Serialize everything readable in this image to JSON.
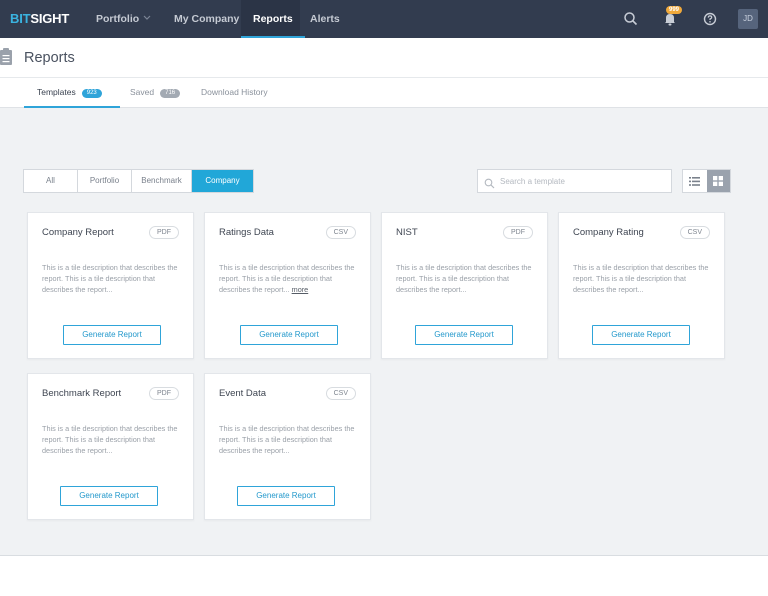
{
  "nav": {
    "logo_part1": "BIT",
    "logo_part2": "SIGHT",
    "items": [
      {
        "label": "Portfolio"
      },
      {
        "label": "My Company"
      },
      {
        "label": "Reports"
      },
      {
        "label": "Alerts"
      }
    ],
    "notification_count": "999",
    "avatar_initials": "JD"
  },
  "page": {
    "title": "Reports",
    "tabs": [
      {
        "label": "Templates",
        "count": "923"
      },
      {
        "label": "Saved",
        "count": "716"
      },
      {
        "label": "Download History"
      }
    ]
  },
  "filters": {
    "options": [
      "All",
      "Portfolio",
      "Benchmark",
      "Company"
    ],
    "selected": "Company",
    "search_placeholder": "Search a template"
  },
  "cards": [
    {
      "title": "Company Report",
      "format": "PDF",
      "description": "This is a tile description that describes the report. This is a tile description that describes the report...",
      "more": "",
      "button": "Generate Report"
    },
    {
      "title": "Ratings Data",
      "format": "CSV",
      "description": "This is a tile description that describes the report. This is a tile description that describes the report...",
      "more": "more",
      "button": "Generate Report"
    },
    {
      "title": "NIST",
      "format": "PDF",
      "description": "This is a tile description that describes the report. This is a tile description that describes the report...",
      "more": "",
      "button": "Generate Report"
    },
    {
      "title": "Company Rating",
      "format": "CSV",
      "description": "This is a tile description that describes the report. This is a tile description that describes the report...",
      "more": "",
      "button": "Generate Report"
    },
    {
      "title": "Benchmark Report",
      "format": "PDF",
      "description": "This is a tile description that describes the report. This is a tile description that describes the report...",
      "more": "",
      "button": "Generate Report"
    },
    {
      "title": "Event Data",
      "format": "CSV",
      "description": "This is a tile description that describes the report. This is a tile description that describes the report...",
      "more": "",
      "button": "Generate Report"
    }
  ],
  "colors": {
    "nav_bg": "#323c4f",
    "accent": "#2fa4d9",
    "badge": "#f0a93b",
    "page_bg": "#f0f2f4"
  },
  "icons": [
    "search-icon",
    "bell-icon",
    "help-icon",
    "clipboard-icon",
    "list-view-icon",
    "grid-view-icon",
    "chevron-down-icon"
  ]
}
